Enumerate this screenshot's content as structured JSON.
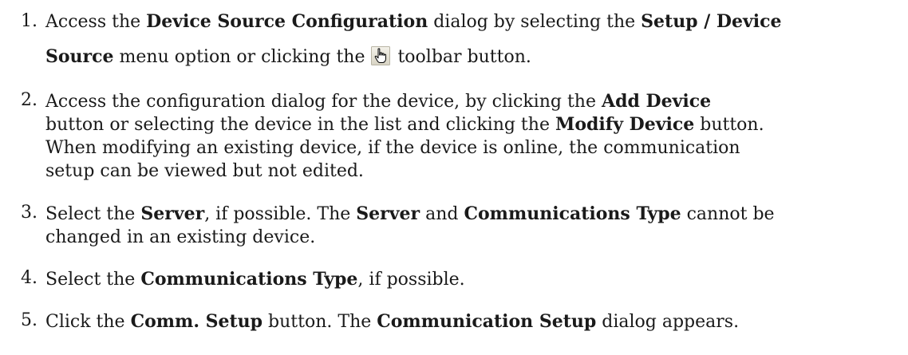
{
  "steps": [
    {
      "number": "1.",
      "line1": {
        "t1": "Access the ",
        "b1": "Device Source Configuration",
        "t2": " dialog by selecting the ",
        "b2": "Setup / Device"
      },
      "line2": {
        "b1": "Source",
        "t1": " menu option or clicking the ",
        "icon": "hand-pointer-icon",
        "t2": " toolbar button."
      }
    },
    {
      "number": "2.",
      "lines": [
        {
          "t1": "Access the configuration dialog for the device, by clicking the ",
          "b1": "Add Device"
        },
        {
          "t1": "button or selecting the device in the list and clicking the ",
          "b1": "Modify Device",
          "t2": " button."
        },
        {
          "t1": "When modifying an existing device, if the device is online, the communication"
        },
        {
          "t1": "setup can be viewed but not edited."
        }
      ]
    },
    {
      "number": "3.",
      "lines": [
        {
          "t1": "Select the ",
          "b1": "Server",
          "t2": ", if possible. The ",
          "b2": "Server",
          "t3": " and ",
          "b3": "Communications Type",
          "t4": " cannot be"
        },
        {
          "t1": "changed in an existing device."
        }
      ]
    },
    {
      "number": "4.",
      "lines": [
        {
          "t1": "Select the ",
          "b1": "Communications Type",
          "t2": ", if possible."
        }
      ]
    },
    {
      "number": "5.",
      "lines": [
        {
          "t1": "Click the ",
          "b1": "Comm. Setup",
          "t2": " button.  The ",
          "b2": "Communication Setup",
          "t3": " dialog appears."
        }
      ]
    }
  ]
}
